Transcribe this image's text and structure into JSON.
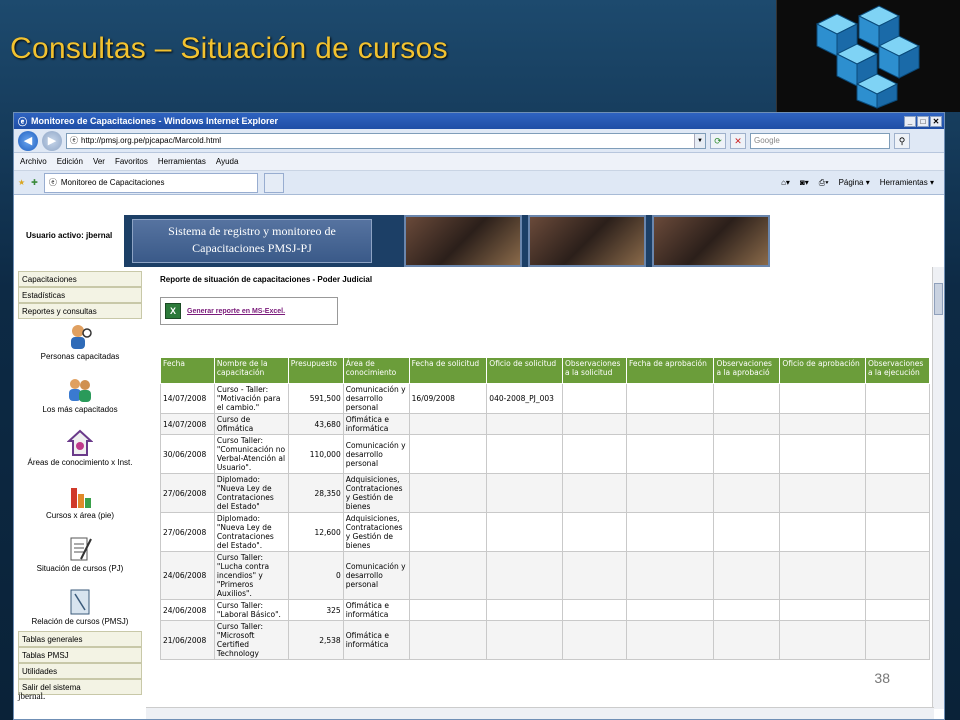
{
  "slide": {
    "title": "Consultas – Situación de cursos",
    "page_number": "38"
  },
  "browser": {
    "window_title": "Monitoreo de Capacitaciones - Windows Internet Explorer",
    "url": "http://pmsj.org.pe/pjcapac/MarcoId.html",
    "search_placeholder": "Google",
    "menu": [
      "Archivo",
      "Edición",
      "Ver",
      "Favoritos",
      "Herramientas",
      "Ayuda"
    ],
    "tab_label": "Monitoreo de Capacitaciones",
    "cmd_pagina": "Página",
    "cmd_herramientas": "Herramientas"
  },
  "app": {
    "active_user_label": "Usuario activo: jbernal",
    "banner_line1": "Sistema de registro y monitoreo de",
    "banner_line2": "Capacitaciones PMSJ-PJ",
    "sidebar_top": [
      "Capacitaciones",
      "Estadísticas",
      "Reportes y consultas"
    ],
    "sidebar_entries": [
      {
        "label": "Personas capacitadas",
        "icon": "person-search-icon"
      },
      {
        "label": "Los más capacitados",
        "icon": "people-icon"
      },
      {
        "label": "Áreas de conocimiento x Inst.",
        "icon": "house-icon"
      },
      {
        "label": "Cursos x área (pie)",
        "icon": "pie-chart-icon"
      },
      {
        "label": "Situación de cursos (PJ)",
        "icon": "document-icon"
      },
      {
        "label": "Relación de cursos (PMSJ)",
        "icon": "notebook-icon"
      }
    ],
    "sidebar_bottom": [
      "Tablas generales",
      "Tablas PMSJ",
      "Utilidades",
      "Salir del sistema"
    ],
    "footer_user": "jbernal.",
    "report_title": "Reporte de situación de capacitaciones - Poder Judicial",
    "excel_link": "Generar reporte en MS-Excel.",
    "columns": [
      "Fecha",
      "Nombre de la capacitación",
      "Presupuesto",
      "Área de conocimiento",
      "Fecha de solicitud",
      "Oficio de solicitud",
      "Observaciones a la solicitud",
      "Fecha de aprobación",
      "Observaciones a la aprobació",
      "Oficio de aprobación",
      "Observaciones a la ejecución"
    ],
    "rows": [
      [
        "14/07/2008",
        "Curso - Taller: \"Motivación para el cambio.\"",
        "591,500",
        "Comunicación y desarrollo personal",
        "16/09/2008",
        "040-2008_PJ_003",
        "",
        "",
        "",
        "",
        ""
      ],
      [
        "14/07/2008",
        "Curso de Ofimática",
        "43,680",
        "Ofimática e informática",
        "",
        "",
        "",
        "",
        "",
        "",
        ""
      ],
      [
        "30/06/2008",
        "Curso Taller: \"Comunicación no Verbal-Atención al Usuario\".",
        "110,000",
        "Comunicación y desarrollo personal",
        "",
        "",
        "",
        "",
        "",
        "",
        ""
      ],
      [
        "27/06/2008",
        "Diplomado: \"Nueva Ley de Contrataciones del Estado\"",
        "28,350",
        "Adquisiciones, Contrataciones y Gestión de bienes",
        "",
        "",
        "",
        "",
        "",
        "",
        ""
      ],
      [
        "27/06/2008",
        "Diplomado: \"Nueva Ley de Contrataciones del Estado\".",
        "12,600",
        "Adquisiciones, Contrataciones y Gestión de bienes",
        "",
        "",
        "",
        "",
        "",
        "",
        ""
      ],
      [
        "24/06/2008",
        "Curso Taller: \"Lucha contra incendios\" y \"Primeros Auxilios\".",
        "0",
        "Comunicación y desarrollo personal",
        "",
        "",
        "",
        "",
        "",
        "",
        ""
      ],
      [
        "24/06/2008",
        "Curso Taller: \"Laboral Básico\".",
        "325",
        "Ofimática e informática",
        "",
        "",
        "",
        "",
        "",
        "",
        ""
      ],
      [
        "21/06/2008",
        "Curso Taller: \"Microsoft Certified Technology",
        "2,538",
        "Ofimática e informática",
        "",
        "",
        "",
        "",
        "",
        "",
        ""
      ]
    ]
  }
}
